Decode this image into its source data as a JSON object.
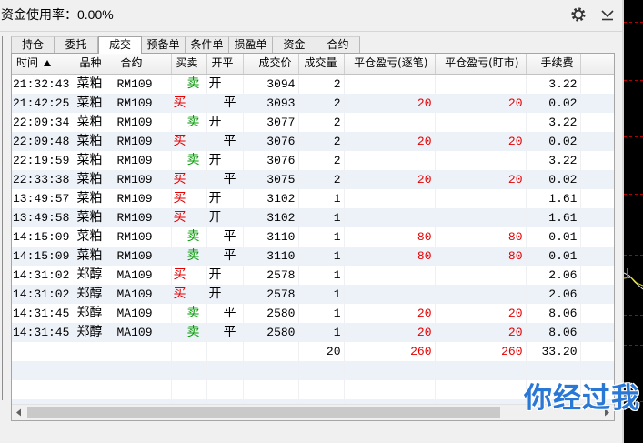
{
  "header": {
    "fund_usage_label": "资金使用率：",
    "fund_usage_value": "0.00%"
  },
  "icons": {
    "settings": "gear-icon",
    "collapse": "chevron-down-icon",
    "sort": "sort-asc-icon",
    "scroll_left": "scroll-left-icon",
    "scroll_right": "scroll-right-icon"
  },
  "tabs": [
    {
      "label": "持仓",
      "active": false
    },
    {
      "label": "委托",
      "active": false
    },
    {
      "label": "成交",
      "active": true
    },
    {
      "label": "预备单",
      "active": false
    },
    {
      "label": "条件单",
      "active": false
    },
    {
      "label": "损盈单",
      "active": false
    },
    {
      "label": "资金",
      "active": false
    },
    {
      "label": "合约",
      "active": false
    }
  ],
  "table": {
    "columns": [
      "时间",
      "品种",
      "合约",
      "买卖",
      "开平",
      "成交价",
      "成交量",
      "平仓盈亏(逐笔)",
      "平仓盈亏(盯市)",
      "手续费"
    ],
    "rows": [
      {
        "time": "21:32:43",
        "product": "菜粕",
        "contract": "RM109",
        "side": "卖",
        "offset": "开",
        "price": "3094",
        "volume": "2",
        "pnl_trade": "",
        "pnl_mark": "",
        "fee": "3.22"
      },
      {
        "time": "21:42:25",
        "product": "菜粕",
        "contract": "RM109",
        "side": "买",
        "offset": "平",
        "price": "3093",
        "volume": "2",
        "pnl_trade": "20",
        "pnl_mark": "20",
        "fee": "0.02"
      },
      {
        "time": "22:09:34",
        "product": "菜粕",
        "contract": "RM109",
        "side": "卖",
        "offset": "开",
        "price": "3077",
        "volume": "2",
        "pnl_trade": "",
        "pnl_mark": "",
        "fee": "3.22"
      },
      {
        "time": "22:09:48",
        "product": "菜粕",
        "contract": "RM109",
        "side": "买",
        "offset": "平",
        "price": "3076",
        "volume": "2",
        "pnl_trade": "20",
        "pnl_mark": "20",
        "fee": "0.02"
      },
      {
        "time": "22:19:59",
        "product": "菜粕",
        "contract": "RM109",
        "side": "卖",
        "offset": "开",
        "price": "3076",
        "volume": "2",
        "pnl_trade": "",
        "pnl_mark": "",
        "fee": "3.22"
      },
      {
        "time": "22:33:38",
        "product": "菜粕",
        "contract": "RM109",
        "side": "买",
        "offset": "平",
        "price": "3075",
        "volume": "2",
        "pnl_trade": "20",
        "pnl_mark": "20",
        "fee": "0.02"
      },
      {
        "time": "13:49:57",
        "product": "菜粕",
        "contract": "RM109",
        "side": "买",
        "offset": "开",
        "price": "3102",
        "volume": "1",
        "pnl_trade": "",
        "pnl_mark": "",
        "fee": "1.61"
      },
      {
        "time": "13:49:58",
        "product": "菜粕",
        "contract": "RM109",
        "side": "买",
        "offset": "开",
        "price": "3102",
        "volume": "1",
        "pnl_trade": "",
        "pnl_mark": "",
        "fee": "1.61"
      },
      {
        "time": "14:15:09",
        "product": "菜粕",
        "contract": "RM109",
        "side": "卖",
        "offset": "平",
        "price": "3110",
        "volume": "1",
        "pnl_trade": "80",
        "pnl_mark": "80",
        "fee": "0.01"
      },
      {
        "time": "14:15:09",
        "product": "菜粕",
        "contract": "RM109",
        "side": "卖",
        "offset": "平",
        "price": "3110",
        "volume": "1",
        "pnl_trade": "80",
        "pnl_mark": "80",
        "fee": "0.01"
      },
      {
        "time": "14:31:02",
        "product": "郑醇",
        "contract": "MA109",
        "side": "买",
        "offset": "开",
        "price": "2578",
        "volume": "1",
        "pnl_trade": "",
        "pnl_mark": "",
        "fee": "2.06"
      },
      {
        "time": "14:31:02",
        "product": "郑醇",
        "contract": "MA109",
        "side": "买",
        "offset": "开",
        "price": "2578",
        "volume": "1",
        "pnl_trade": "",
        "pnl_mark": "",
        "fee": "2.06"
      },
      {
        "time": "14:31:45",
        "product": "郑醇",
        "contract": "MA109",
        "side": "卖",
        "offset": "平",
        "price": "2580",
        "volume": "1",
        "pnl_trade": "20",
        "pnl_mark": "20",
        "fee": "8.06"
      },
      {
        "time": "14:31:45",
        "product": "郑醇",
        "contract": "MA109",
        "side": "卖",
        "offset": "平",
        "price": "2580",
        "volume": "1",
        "pnl_trade": "20",
        "pnl_mark": "20",
        "fee": "8.06"
      }
    ],
    "summary": {
      "volume": "20",
      "pnl_trade": "260",
      "pnl_mark": "260",
      "fee": "33.20"
    }
  },
  "watermark": "你经过我",
  "colors": {
    "pnl": "#e60000",
    "row_alt": "#edf1f8",
    "watermark": "#2a78d6",
    "side_colors": {
      "买": "#e60000",
      "卖": "#009a00"
    }
  }
}
